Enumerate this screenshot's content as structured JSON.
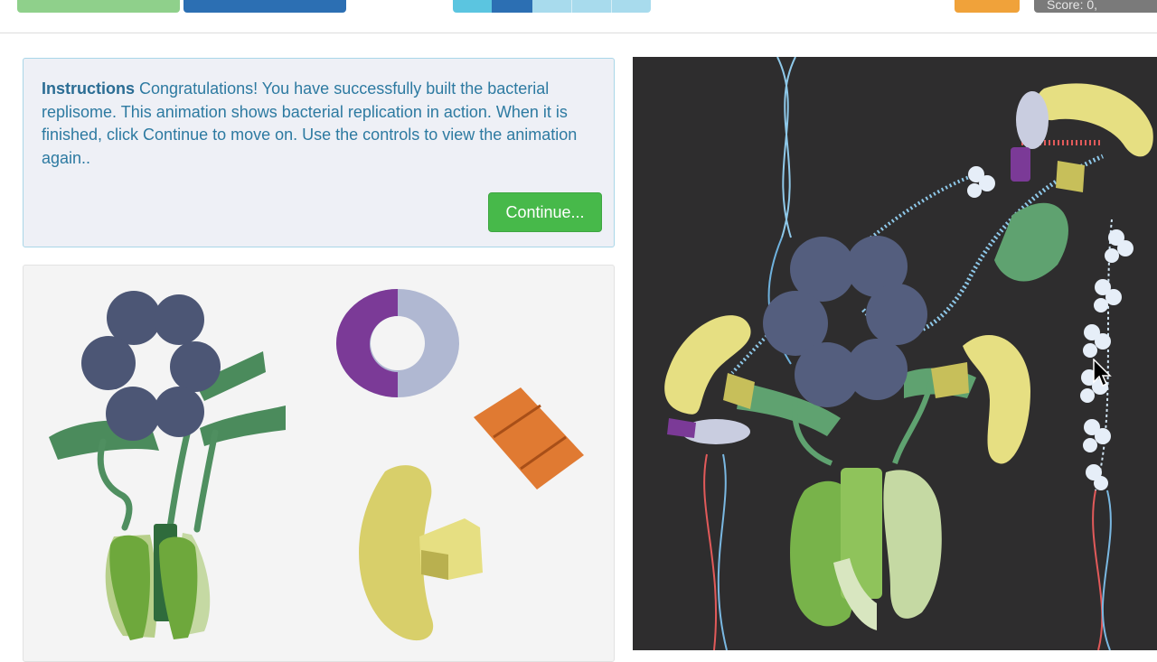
{
  "topbar": {
    "status_text": "Score: 0,"
  },
  "instructions": {
    "heading": "Instructions",
    "body": "Congratulations! You have successfully built the bacterial replisome. This animation shows bacterial replication in action. When it is finished, click Continue to move on. Use the controls to view the animation again..",
    "continue_label": "Continue..."
  },
  "colors": {
    "accent_green": "#47b94a",
    "instruction_text": "#2d7aa1",
    "animation_background": "#2e2d2e",
    "helicase": "#4c5675",
    "polymerase_yellow": "#e6df82",
    "clamp_purple": "#7b3a97",
    "primase_orange": "#e07a32"
  }
}
